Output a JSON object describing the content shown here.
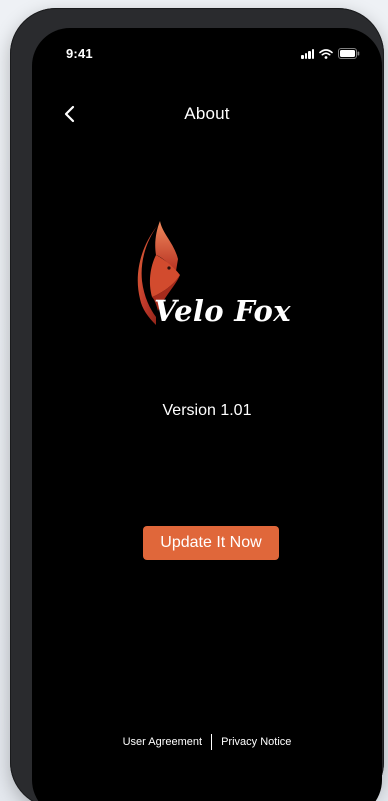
{
  "status_bar": {
    "time": "9:41"
  },
  "nav": {
    "title": "About",
    "back_icon": "chevron-left-icon"
  },
  "brand": {
    "name": "Velo Fox",
    "logo_icon": "fox-logo-icon",
    "logo_colors": [
      "#c0392b",
      "#e0673a",
      "#8e2418"
    ]
  },
  "version": {
    "label": "Version 1.01"
  },
  "update_button": {
    "label": "Update It Now",
    "color": "#e0673a"
  },
  "footer": {
    "user_agreement": "User Agreement",
    "privacy_notice": "Privacy Notice"
  }
}
